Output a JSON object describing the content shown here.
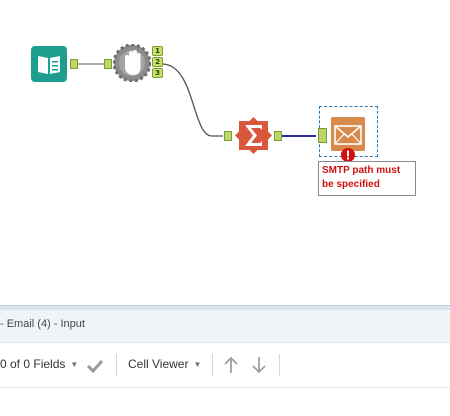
{
  "workflow": {
    "tools": [
      {
        "name": "input-data-tool",
        "icon": "book-icon"
      },
      {
        "name": "test-tool",
        "icon": "hand-stop-icon",
        "outputs": [
          "1",
          "2",
          "3"
        ]
      },
      {
        "name": "summarize-tool",
        "icon": "sigma-icon"
      },
      {
        "name": "email-tool",
        "icon": "envelope-icon",
        "status": "error"
      }
    ],
    "error_message": "SMTP path must be specified",
    "colors": {
      "input_tool": "#1c9f8f",
      "summarize_tool": "#d9573c",
      "email_tool": "#d88a4a",
      "anchor": "#b9d66a",
      "error": "#d01010",
      "selected_connection": "#2d2f9e"
    }
  },
  "results_panel": {
    "title": "- Email (4) - Input",
    "fields_label": "0 of 0 Fields",
    "cell_viewer_label": "Cell Viewer"
  }
}
